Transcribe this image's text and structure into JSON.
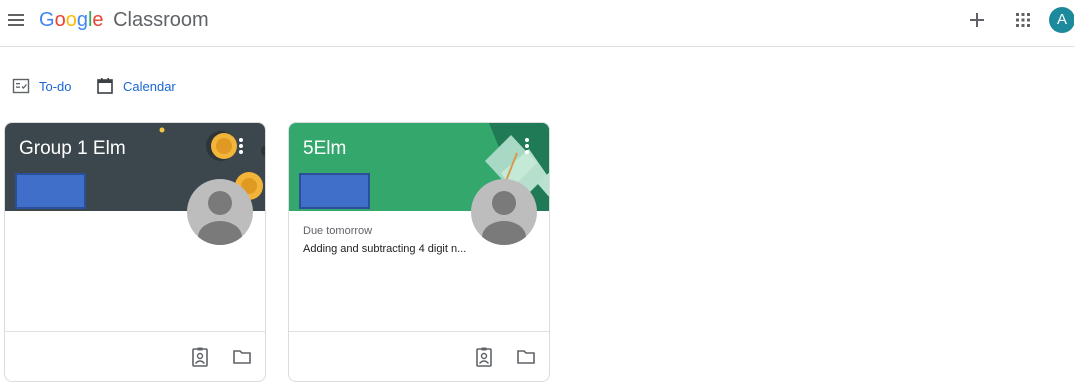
{
  "app": {
    "brand_google": "Google",
    "brand_product": "Classroom",
    "avatar_initial": "A",
    "avatar_color": "#1c8a9c"
  },
  "nav": {
    "todo_label": "To-do",
    "calendar_label": "Calendar"
  },
  "cards": [
    {
      "title": "Group 1 Elm",
      "header_color": "#3c474d",
      "due_label": "",
      "due_item": ""
    },
    {
      "title": "5Elm",
      "header_color": "#34a86c",
      "due_label": "Due tomorrow",
      "due_item": "Adding and subtracting 4 digit n..."
    }
  ],
  "icons": [
    "menu-icon",
    "plus-icon",
    "apps-grid-icon",
    "todo-icon",
    "calendar-icon",
    "more-vert-icon",
    "assignment-ind-icon",
    "folder-icon"
  ]
}
